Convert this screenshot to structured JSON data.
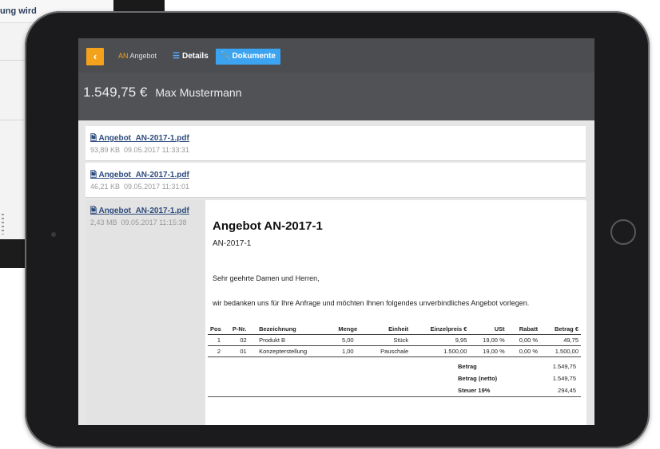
{
  "background_window": {
    "text": "ung wird"
  },
  "topbar": {
    "back_icon": "chevron-left-icon",
    "brand_prefix": "AN",
    "brand_label": "Angebot",
    "tab_details": "Details",
    "tab_documents": "Dokumente",
    "accent_color": "#f4a21c",
    "active_tab_color": "#3ca3f0"
  },
  "header": {
    "amount": "1.549,75 €",
    "customer": "Max Mustermann"
  },
  "documents": [
    {
      "name": "Angebot_AN-2017-1.pdf",
      "size": "93,89 KB",
      "date": "09.05.2017 11:33:31"
    },
    {
      "name": "Angebot_AN-2017-1.pdf",
      "size": "46,21 KB",
      "date": "09.05.2017 11:31:01"
    },
    {
      "name": "Angebot_AN-2017-1.pdf",
      "size": "2,43 MB",
      "date": "09.05.2017 11:15:38"
    }
  ],
  "preview": {
    "title": "Angebot AN-2017-1",
    "number": "AN-2017-1",
    "greeting": "Sehr geehrte Damen und Herren,",
    "intro": "wir bedanken uns für Ihre Anfrage und möchten Ihnen folgendes unverbindliches Angebot vorlegen.",
    "columns": [
      "Pos",
      "P-Nr.",
      "Bezeichnung",
      "Menge",
      "Einheit",
      "Einzelpreis €",
      "USt",
      "Rabatt",
      "Betrag €"
    ],
    "rows": [
      [
        "1",
        "02",
        "Produkt B",
        "5,00",
        "Stück",
        "9,95",
        "19,00 %",
        "0,00 %",
        "49,75"
      ],
      [
        "2",
        "01",
        "Konzepterstellung",
        "1,00",
        "Pauschale",
        "1.500,00",
        "19,00 %",
        "0,00 %",
        "1.500,00"
      ]
    ],
    "totals": [
      {
        "label": "Betrag",
        "value": "1.549,75"
      },
      {
        "label": "Betrag (netto)",
        "value": "1.549,75"
      },
      {
        "label": "Steuer 19%",
        "value": "294,45"
      }
    ]
  }
}
